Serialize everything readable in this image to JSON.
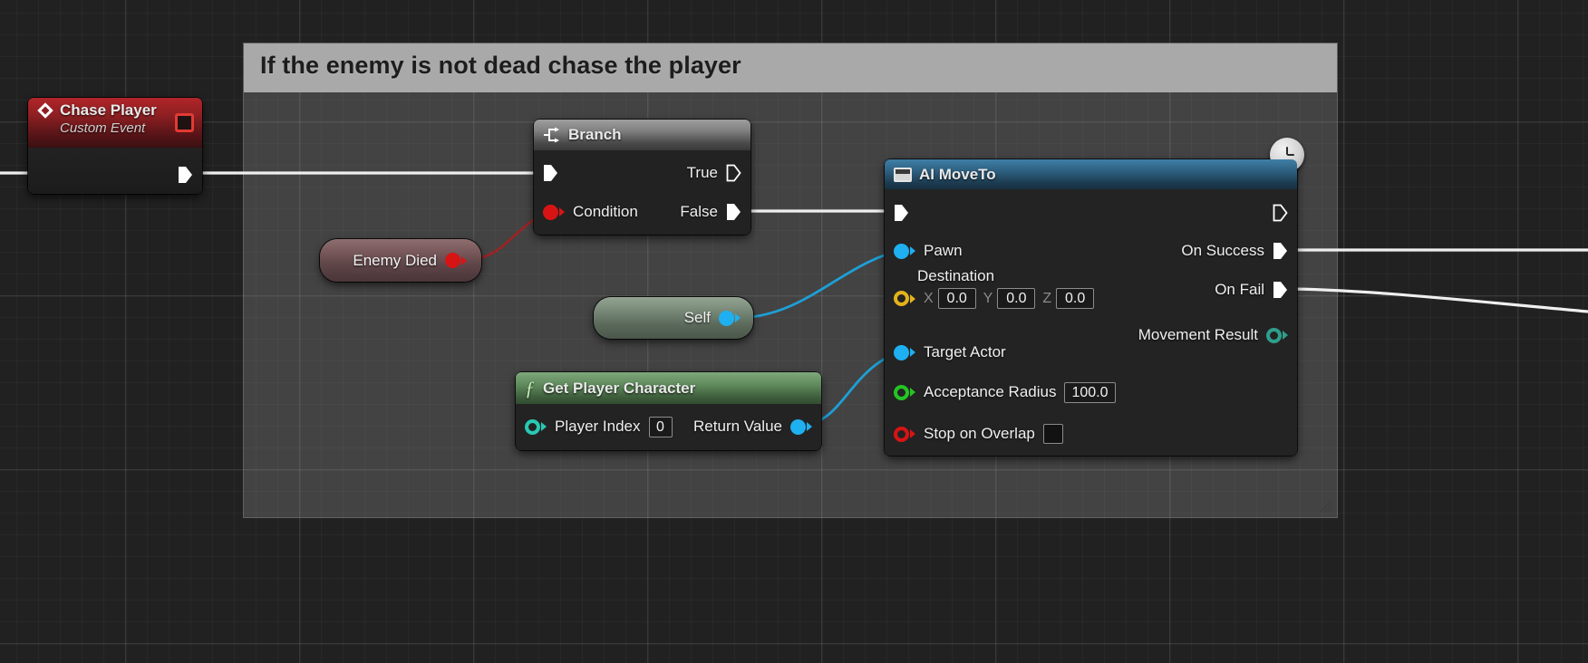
{
  "editor": {
    "name": "Unreal Engine Blueprint Graph",
    "background_color": "#212121"
  },
  "comment": {
    "title": "If the enemy is not dead chase the player",
    "header_color": "#a9a9a9",
    "body_color": "#a8a8a8"
  },
  "nodes": {
    "chase_player_event": {
      "title": "Chase Player",
      "subtitle": "Custom Event",
      "icon": "event-diamond-icon",
      "accent": "#b12528",
      "outputs": [
        {
          "label": "",
          "pin": "exec-out"
        }
      ]
    },
    "branch": {
      "title": "Branch",
      "icon": "branch-icon",
      "inputs": [
        {
          "label": "",
          "pin": "exec-in"
        },
        {
          "label": "Condition",
          "pin": "bool-in",
          "color": "#d71414"
        }
      ],
      "outputs": [
        {
          "label": "True",
          "pin": "exec-out-hollow"
        },
        {
          "label": "False",
          "pin": "exec-out-filled"
        }
      ]
    },
    "enemy_died": {
      "label": "Enemy Died",
      "pin_color": "#d71414"
    },
    "self_node": {
      "label": "Self",
      "pin_color": "#1eb0f0"
    },
    "get_player_character": {
      "title": "Get Player Character",
      "icon": "function-f-icon",
      "accent": "#5f8a5c",
      "inputs": [
        {
          "label": "Player Index",
          "value": "0",
          "color": "#28c8b4"
        }
      ],
      "outputs": [
        {
          "label": "Return Value",
          "color": "#1eb0f0"
        }
      ]
    },
    "ai_move_to": {
      "title": "AI MoveTo",
      "icon": "node-window-icon",
      "accent": "#2d5f80",
      "latent_badge": "clock-icon",
      "inputs": [
        {
          "label": "",
          "pin": "exec-in"
        },
        {
          "label": "Pawn",
          "color": "#1eb0f0"
        },
        {
          "label": "Destination",
          "color": "#e3b21c",
          "fields": [
            {
              "axis": "X",
              "value": "0.0"
            },
            {
              "axis": "Y",
              "value": "0.0"
            },
            {
              "axis": "Z",
              "value": "0.0"
            }
          ]
        },
        {
          "label": "Target Actor",
          "color": "#1eb0f0"
        },
        {
          "label": "Acceptance Radius",
          "value": "100.0",
          "color": "#25c425"
        },
        {
          "label": "Stop on Overlap",
          "checked": false,
          "color": "#d71414"
        }
      ],
      "outputs": [
        {
          "label": "",
          "pin": "exec-out"
        },
        {
          "label": "On Success",
          "pin": "exec-out-filled"
        },
        {
          "label": "On Fail",
          "pin": "exec-out-filled"
        },
        {
          "label": "Movement Result",
          "color": "#2f9e8c"
        }
      ]
    }
  },
  "wires": {
    "exec_color": "#efefef",
    "bool_color": "#b02020",
    "object_color": "#1e9fd6"
  }
}
